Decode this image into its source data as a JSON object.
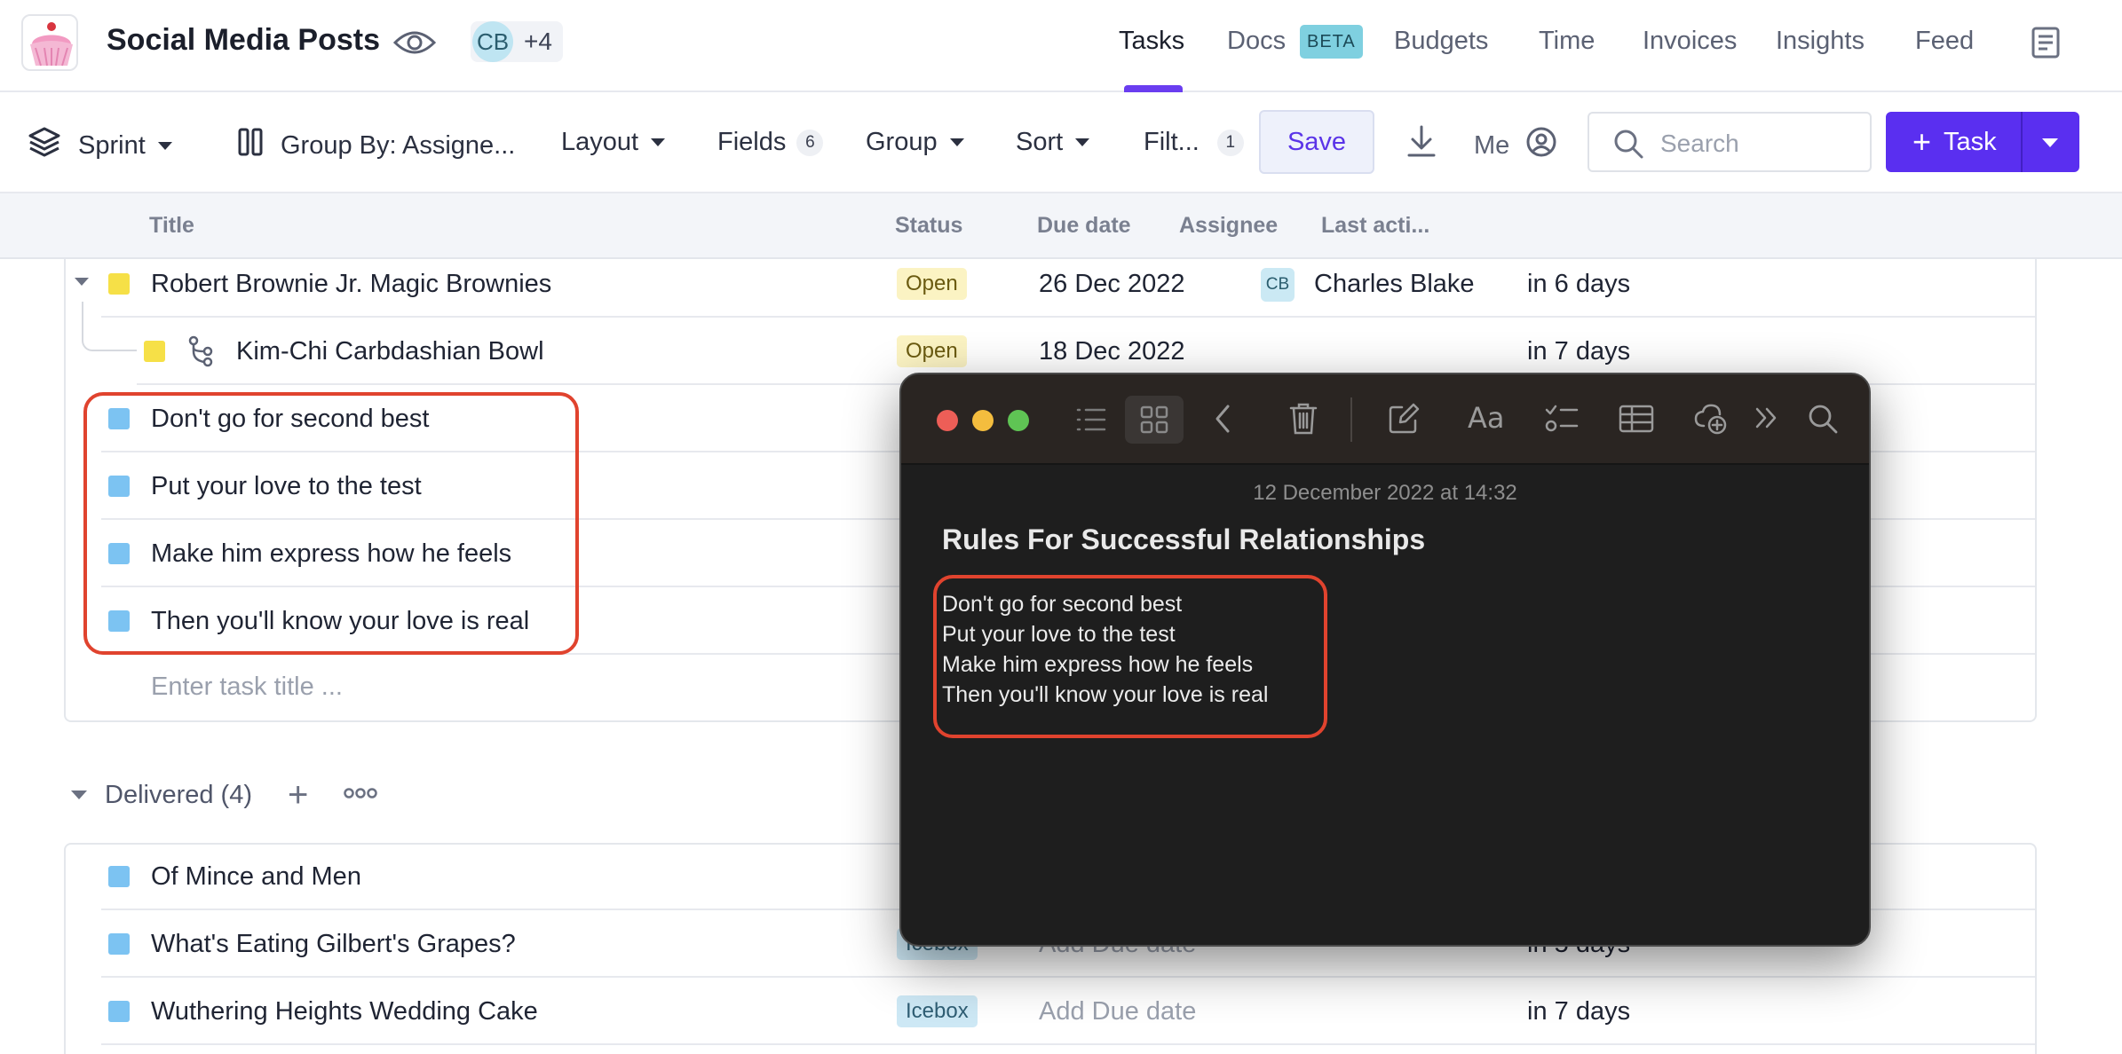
{
  "header": {
    "project_title": "Social Media Posts",
    "avatar_initials": "CB",
    "avatar_more": "+4",
    "nav": {
      "tasks": "Tasks",
      "docs": "Docs",
      "docs_badge": "BETA",
      "budgets": "Budgets",
      "time": "Time",
      "invoices": "Invoices",
      "insights": "Insights",
      "feed": "Feed"
    },
    "accent_color": "#6a3df0"
  },
  "toolbar": {
    "sprint": "Sprint",
    "group_by": "Group By: Assigne...",
    "layout": "Layout",
    "fields": "Fields",
    "fields_count": "6",
    "group": "Group",
    "sort": "Sort",
    "filter": "Filt...",
    "filter_count": "1",
    "save": "Save",
    "me": "Me",
    "search_placeholder": "Search",
    "task_button": "Task"
  },
  "columns": {
    "title": "Title",
    "status": "Status",
    "due_date": "Due date",
    "assignee": "Assignee",
    "last_activity": "Last acti..."
  },
  "rows": [
    {
      "title": "Robert Brownie Jr. Magic Brownies",
      "status": "Open",
      "due": "26 Dec 2022",
      "assignee_initials": "CB",
      "assignee": "Charles Blake",
      "last": "in 6 days"
    },
    {
      "title": "Kim-Chi Carbdashian Bowl",
      "status": "Open",
      "due": "18 Dec 2022",
      "last": "in 7 days"
    },
    {
      "title": "Don't go for second best"
    },
    {
      "title": "Put your love to the test"
    },
    {
      "title": "Make him express how he feels"
    },
    {
      "title": "Then you'll know your love is real"
    }
  ],
  "enter_task_placeholder": "Enter task title ...",
  "delivered_group": {
    "label": "Delivered (4)",
    "rows": [
      {
        "title": "Of Mince and Men"
      },
      {
        "title": "What's Eating Gilbert's Grapes?",
        "status": "Icebox",
        "due": "Add Due date",
        "last": "in 5 days"
      },
      {
        "title": "Wuthering Heights Wedding Cake",
        "status": "Icebox",
        "due": "Add Due date",
        "last": "in 7 days"
      }
    ]
  },
  "notes_window": {
    "date": "12 December 2022 at 14:32",
    "title": "Rules For Successful Relationships",
    "lines": [
      "Don't go for second best",
      "Put your love to the test",
      "Make him express how he feels",
      "Then you'll know your love is real"
    ]
  }
}
